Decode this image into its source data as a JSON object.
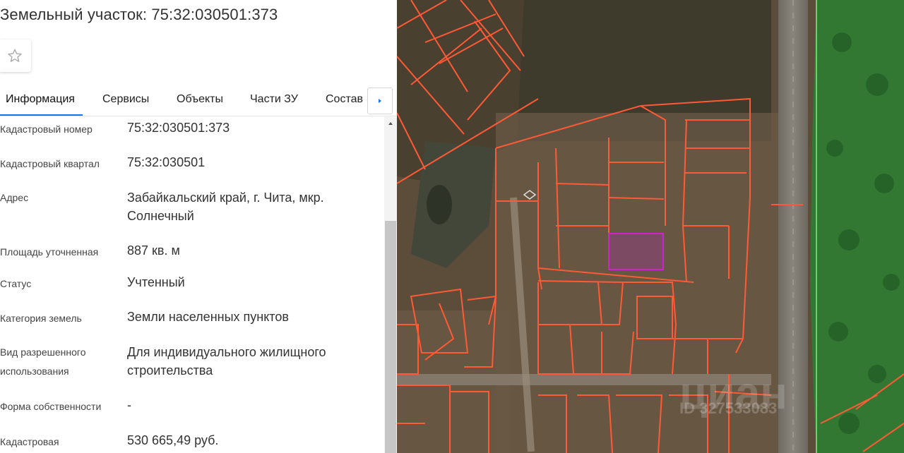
{
  "title": "Земельный участок: 75:32:030501:373",
  "tabs": [
    {
      "label": "Информация"
    },
    {
      "label": "Сервисы"
    },
    {
      "label": "Объекты"
    },
    {
      "label": "Части ЗУ"
    },
    {
      "label": "Состав"
    }
  ],
  "rows": [
    {
      "label": "Кадастровый номер",
      "value": "75:32:030501:373"
    },
    {
      "label": "Кадастровый квартал",
      "value": "75:32:030501"
    },
    {
      "label": "Адрес",
      "value": "Забайкальский край, г. Чита, мкр. Солнечный"
    },
    {
      "label": "Площадь уточненная",
      "value": "887 кв. м"
    },
    {
      "label": "Статус",
      "value": "Учтенный"
    },
    {
      "label": "Категория земель",
      "value": "Земли населенных пунктов"
    },
    {
      "label": "Вид разрешенного использования",
      "value": "Для индивидуального жилищного строительства"
    },
    {
      "label": "Форма собственности",
      "value": "-"
    },
    {
      "label": "Кадастровая",
      "value": "530 665,49 руб."
    }
  ],
  "map": {
    "watermark": "циан",
    "watermark_id": "ID 327533083"
  },
  "icons": {
    "favorite": "star-outline-icon",
    "tab_next": "triangle-right-icon",
    "scroll_up": "triangle-up-icon"
  },
  "colors": {
    "accent": "#1a73e8",
    "parcel_boundary": "#ff5a36",
    "selected_parcel": "#d020d0",
    "green_zone": "#2f7d32"
  }
}
